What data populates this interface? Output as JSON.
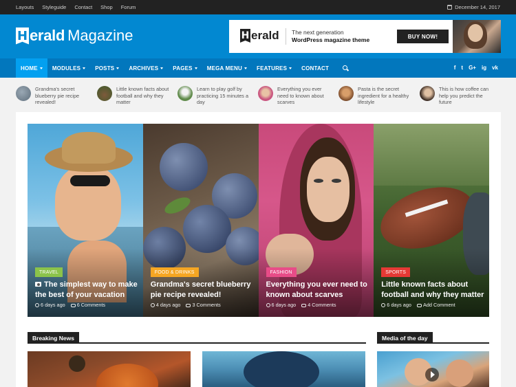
{
  "topbar": {
    "links": [
      "Layouts",
      "Styleguide",
      "Contact",
      "Shop",
      "Forum"
    ],
    "date": "December 14, 2017"
  },
  "header": {
    "logo_mark": "H",
    "logo_bold": "erald",
    "logo_light": "Magazine",
    "ad": {
      "logo_mark": "H",
      "logo_text": "erald",
      "line1": "The next generation",
      "line2": "WordPress magazine theme",
      "button": "BUY NOW!"
    }
  },
  "nav": {
    "items": [
      "HOME",
      "MODULES",
      "POSTS",
      "ARCHIVES",
      "PAGES",
      "MEGA MENU",
      "FEATURES",
      "CONTACT"
    ],
    "social": [
      "f",
      "t",
      "G+",
      "ig",
      "vk"
    ]
  },
  "ticker": [
    {
      "text": "Grandma's secret blueberry pie recipe revealed!",
      "color": "#6b7d8c"
    },
    {
      "text": "Little known facts about football and why they matter",
      "color": "#5a6a42"
    },
    {
      "text": "Learn to play golf by practicing 15 minutes a day",
      "color": "#5f8a4a"
    },
    {
      "text": "Everything you ever need to known about scarves",
      "color": "#c9557f"
    },
    {
      "text": "Pasta is the secret ingredient for a healthy lifestyle",
      "color": "#a2683e"
    },
    {
      "text": "This is how coffee can help you predict the future",
      "color": "#4a3a30"
    }
  ],
  "slides": [
    {
      "category": "TRAVEL",
      "cat_color": "#8bc34a",
      "title": "The simplest way to make the best of your vacation",
      "time": "6 days ago",
      "comments": "6 Comments",
      "has_camera": true
    },
    {
      "category": "FOOD & DRINKS",
      "cat_color": "#f5a623",
      "title": "Grandma's secret blueberry pie recipe revealed!",
      "time": "4 days ago",
      "comments": "3 Comments",
      "has_camera": false
    },
    {
      "category": "FASHION",
      "cat_color": "#e84c88",
      "title": "Everything you ever need to known about scarves",
      "time": "6 days ago",
      "comments": "4 Comments",
      "has_camera": false
    },
    {
      "category": "SPORTS",
      "cat_color": "#e53935",
      "title": "Little known facts about football and why they matter",
      "time": "6 days ago",
      "comments": "Add Comment",
      "has_camera": false
    }
  ],
  "sections": {
    "breaking": "Breaking News",
    "media": "Media of the day"
  }
}
